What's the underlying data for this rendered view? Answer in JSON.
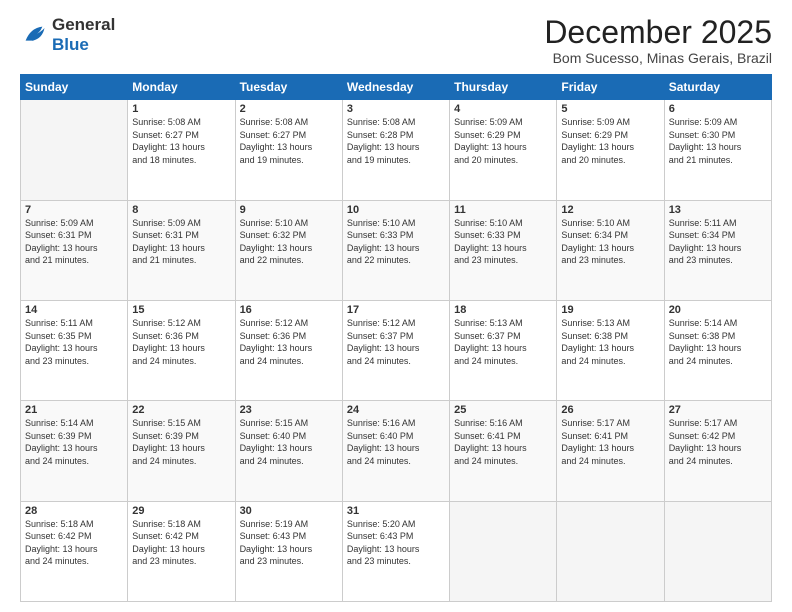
{
  "logo": {
    "line1": "General",
    "line2": "Blue"
  },
  "title": "December 2025",
  "location": "Bom Sucesso, Minas Gerais, Brazil",
  "days_of_week": [
    "Sunday",
    "Monday",
    "Tuesday",
    "Wednesday",
    "Thursday",
    "Friday",
    "Saturday"
  ],
  "weeks": [
    [
      {
        "num": "",
        "info": ""
      },
      {
        "num": "1",
        "info": "Sunrise: 5:08 AM\nSunset: 6:27 PM\nDaylight: 13 hours\nand 18 minutes."
      },
      {
        "num": "2",
        "info": "Sunrise: 5:08 AM\nSunset: 6:27 PM\nDaylight: 13 hours\nand 19 minutes."
      },
      {
        "num": "3",
        "info": "Sunrise: 5:08 AM\nSunset: 6:28 PM\nDaylight: 13 hours\nand 19 minutes."
      },
      {
        "num": "4",
        "info": "Sunrise: 5:09 AM\nSunset: 6:29 PM\nDaylight: 13 hours\nand 20 minutes."
      },
      {
        "num": "5",
        "info": "Sunrise: 5:09 AM\nSunset: 6:29 PM\nDaylight: 13 hours\nand 20 minutes."
      },
      {
        "num": "6",
        "info": "Sunrise: 5:09 AM\nSunset: 6:30 PM\nDaylight: 13 hours\nand 21 minutes."
      }
    ],
    [
      {
        "num": "7",
        "info": "Sunrise: 5:09 AM\nSunset: 6:31 PM\nDaylight: 13 hours\nand 21 minutes."
      },
      {
        "num": "8",
        "info": "Sunrise: 5:09 AM\nSunset: 6:31 PM\nDaylight: 13 hours\nand 21 minutes."
      },
      {
        "num": "9",
        "info": "Sunrise: 5:10 AM\nSunset: 6:32 PM\nDaylight: 13 hours\nand 22 minutes."
      },
      {
        "num": "10",
        "info": "Sunrise: 5:10 AM\nSunset: 6:33 PM\nDaylight: 13 hours\nand 22 minutes."
      },
      {
        "num": "11",
        "info": "Sunrise: 5:10 AM\nSunset: 6:33 PM\nDaylight: 13 hours\nand 23 minutes."
      },
      {
        "num": "12",
        "info": "Sunrise: 5:10 AM\nSunset: 6:34 PM\nDaylight: 13 hours\nand 23 minutes."
      },
      {
        "num": "13",
        "info": "Sunrise: 5:11 AM\nSunset: 6:34 PM\nDaylight: 13 hours\nand 23 minutes."
      }
    ],
    [
      {
        "num": "14",
        "info": "Sunrise: 5:11 AM\nSunset: 6:35 PM\nDaylight: 13 hours\nand 23 minutes."
      },
      {
        "num": "15",
        "info": "Sunrise: 5:12 AM\nSunset: 6:36 PM\nDaylight: 13 hours\nand 24 minutes."
      },
      {
        "num": "16",
        "info": "Sunrise: 5:12 AM\nSunset: 6:36 PM\nDaylight: 13 hours\nand 24 minutes."
      },
      {
        "num": "17",
        "info": "Sunrise: 5:12 AM\nSunset: 6:37 PM\nDaylight: 13 hours\nand 24 minutes."
      },
      {
        "num": "18",
        "info": "Sunrise: 5:13 AM\nSunset: 6:37 PM\nDaylight: 13 hours\nand 24 minutes."
      },
      {
        "num": "19",
        "info": "Sunrise: 5:13 AM\nSunset: 6:38 PM\nDaylight: 13 hours\nand 24 minutes."
      },
      {
        "num": "20",
        "info": "Sunrise: 5:14 AM\nSunset: 6:38 PM\nDaylight: 13 hours\nand 24 minutes."
      }
    ],
    [
      {
        "num": "21",
        "info": "Sunrise: 5:14 AM\nSunset: 6:39 PM\nDaylight: 13 hours\nand 24 minutes."
      },
      {
        "num": "22",
        "info": "Sunrise: 5:15 AM\nSunset: 6:39 PM\nDaylight: 13 hours\nand 24 minutes."
      },
      {
        "num": "23",
        "info": "Sunrise: 5:15 AM\nSunset: 6:40 PM\nDaylight: 13 hours\nand 24 minutes."
      },
      {
        "num": "24",
        "info": "Sunrise: 5:16 AM\nSunset: 6:40 PM\nDaylight: 13 hours\nand 24 minutes."
      },
      {
        "num": "25",
        "info": "Sunrise: 5:16 AM\nSunset: 6:41 PM\nDaylight: 13 hours\nand 24 minutes."
      },
      {
        "num": "26",
        "info": "Sunrise: 5:17 AM\nSunset: 6:41 PM\nDaylight: 13 hours\nand 24 minutes."
      },
      {
        "num": "27",
        "info": "Sunrise: 5:17 AM\nSunset: 6:42 PM\nDaylight: 13 hours\nand 24 minutes."
      }
    ],
    [
      {
        "num": "28",
        "info": "Sunrise: 5:18 AM\nSunset: 6:42 PM\nDaylight: 13 hours\nand 24 minutes."
      },
      {
        "num": "29",
        "info": "Sunrise: 5:18 AM\nSunset: 6:42 PM\nDaylight: 13 hours\nand 23 minutes."
      },
      {
        "num": "30",
        "info": "Sunrise: 5:19 AM\nSunset: 6:43 PM\nDaylight: 13 hours\nand 23 minutes."
      },
      {
        "num": "31",
        "info": "Sunrise: 5:20 AM\nSunset: 6:43 PM\nDaylight: 13 hours\nand 23 minutes."
      },
      {
        "num": "",
        "info": ""
      },
      {
        "num": "",
        "info": ""
      },
      {
        "num": "",
        "info": ""
      }
    ]
  ]
}
